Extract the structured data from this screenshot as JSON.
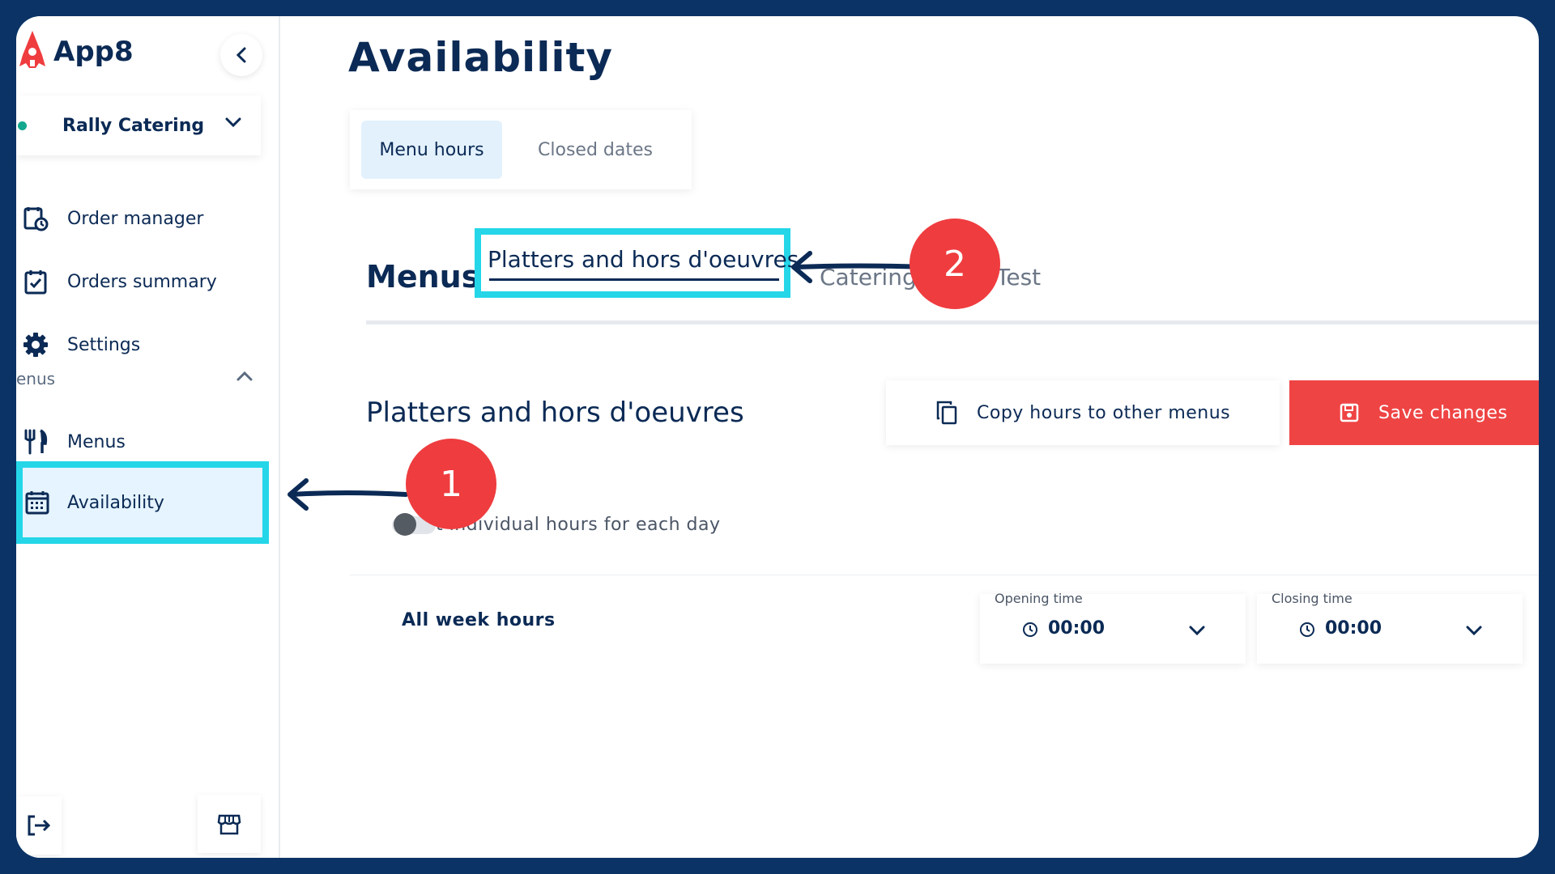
{
  "app": {
    "name": "App8"
  },
  "sidebar": {
    "store": "Rally Catering",
    "items": [
      {
        "label": "Order manager",
        "icon": "order-manager-icon"
      },
      {
        "label": "Orders summary",
        "icon": "clipboard-check-icon"
      },
      {
        "label": "Settings",
        "icon": "gear-icon"
      }
    ],
    "section_label": "enus",
    "sub_items": [
      {
        "label": "Menus",
        "icon": "fork-knife-icon"
      },
      {
        "label": "Availability",
        "icon": "calendar-icon"
      }
    ]
  },
  "page": {
    "title": "Availability",
    "tabs": [
      {
        "label": "Menu hours",
        "active": true
      },
      {
        "label": "Closed dates",
        "active": false
      }
    ],
    "menus_label": "Menus:",
    "menu_tabs": [
      {
        "label": "Platters and hors d'oeuvres",
        "active": true
      },
      {
        "label": "Catering m",
        "active": false
      },
      {
        "label": "Test",
        "active": false
      }
    ],
    "section_title": "Platters and hors d'oeuvres",
    "copy_button": "Copy hours to other menus",
    "save_button": "Save changes",
    "toggle_label": "t individual hours for each day",
    "toggle_on": false,
    "week_row": {
      "label": "All week hours",
      "opening": {
        "caption": "Opening time",
        "value": "00:00"
      },
      "closing": {
        "caption": "Closing time",
        "value": "00:00"
      }
    }
  },
  "annotations": [
    {
      "number": "1"
    },
    {
      "number": "2"
    }
  ],
  "colors": {
    "navy": "#0b2a55",
    "highlight": "#24d6e8",
    "danger": "#ef4444",
    "active_bg": "#e5f4ff"
  }
}
